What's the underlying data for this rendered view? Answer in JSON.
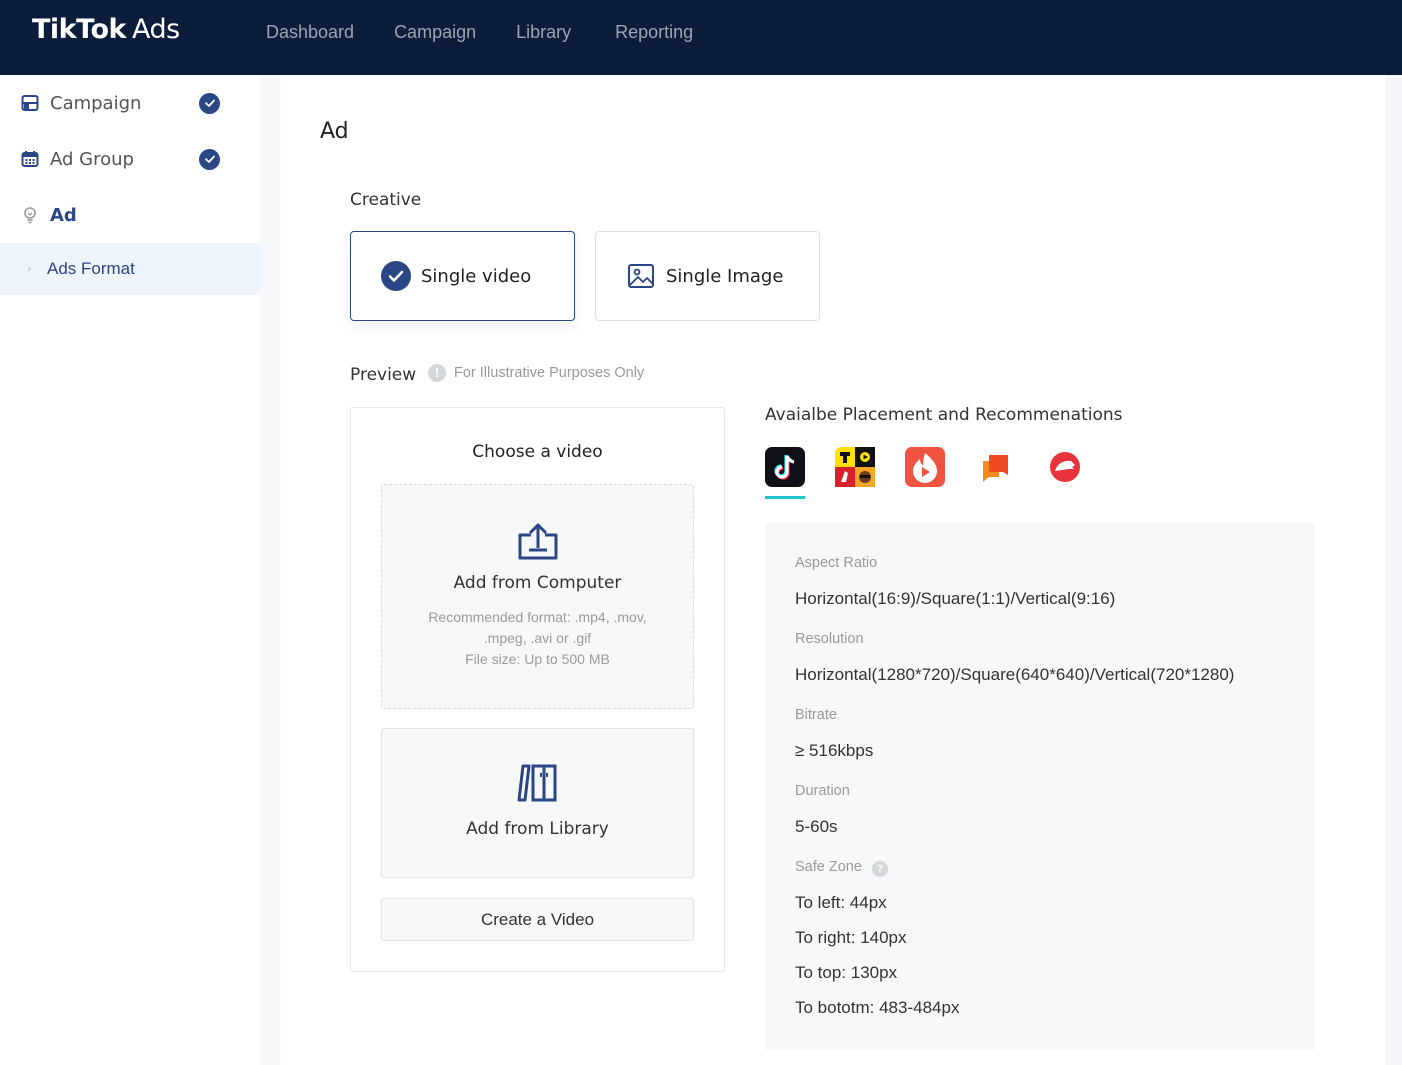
{
  "app": {
    "logo_main": "TikTok",
    "logo_sub": "Ads"
  },
  "nav": {
    "items": [
      {
        "label": "Dashboard"
      },
      {
        "label": "Campaign"
      },
      {
        "label": "Library"
      },
      {
        "label": "Reporting"
      }
    ]
  },
  "sidebar": {
    "items": [
      {
        "label": "Campaign",
        "icon": "layout-icon",
        "completed": true
      },
      {
        "label": "Ad Group",
        "icon": "calendar-icon",
        "completed": true
      },
      {
        "label": "Ad",
        "icon": "lightbulb-icon",
        "completed": false,
        "active": true
      }
    ],
    "sub_items": [
      {
        "label": "Ads Format",
        "active": true
      }
    ]
  },
  "main": {
    "title": "Ad",
    "creative": {
      "label": "Creative",
      "options": [
        {
          "label": "Single video",
          "icon": "check-circle-icon",
          "selected": true
        },
        {
          "label": "Single Image",
          "icon": "image-icon",
          "selected": false
        }
      ]
    },
    "preview": {
      "label": "Preview",
      "note": "For Illustrative Purposes Only",
      "note_icon": "!",
      "title": "Choose a video",
      "upload": {
        "title": "Add from Computer",
        "hint_line1": "Recommended format: .mp4, .mov,",
        "hint_line2": ".mpeg, .avi or .gif",
        "hint_line3": "File size: Up to 500 MB"
      },
      "library": {
        "title": "Add from Library"
      },
      "create_button": "Create a Video"
    },
    "placement": {
      "title": "Avaialbe Placement and Recommenations",
      "apps": [
        {
          "name": "TikTok",
          "icon": "tiktok-app-icon",
          "selected": true
        },
        {
          "name": "TopBuzz",
          "icon": "topbuzz-app-icon",
          "selected": false
        },
        {
          "name": "Vigo Video",
          "icon": "vigo-video-app-icon",
          "selected": false
        },
        {
          "name": "BuzzVideo",
          "icon": "chat-app-icon",
          "selected": false
        },
        {
          "name": "Pangle",
          "icon": "pangle-app-icon",
          "selected": false
        }
      ],
      "accent_color": "#20c4c8"
    },
    "specs": {
      "aspect_ratio_label": "Aspect Ratio",
      "aspect_ratio_value": "Horizontal(16:9)/Square(1:1)/Vertical(9:16)",
      "resolution_label": "Resolution",
      "resolution_value": "Horizontal(1280*720)/Square(640*640)/Vertical(720*1280)",
      "bitrate_label": "Bitrate",
      "bitrate_value": "≥ 516kbps",
      "duration_label": "Duration",
      "duration_value": "5-60s",
      "safe_zone_label": "Safe Zone",
      "safe_zone_help": "?",
      "safe_zone": [
        "To left: 44px",
        "To right: 140px",
        "To top: 130px",
        "To bototm: 483-484px"
      ]
    }
  },
  "colors": {
    "topbar": "#0b1d3a",
    "primary": "#2b4684",
    "accent": "#20c4c8"
  }
}
